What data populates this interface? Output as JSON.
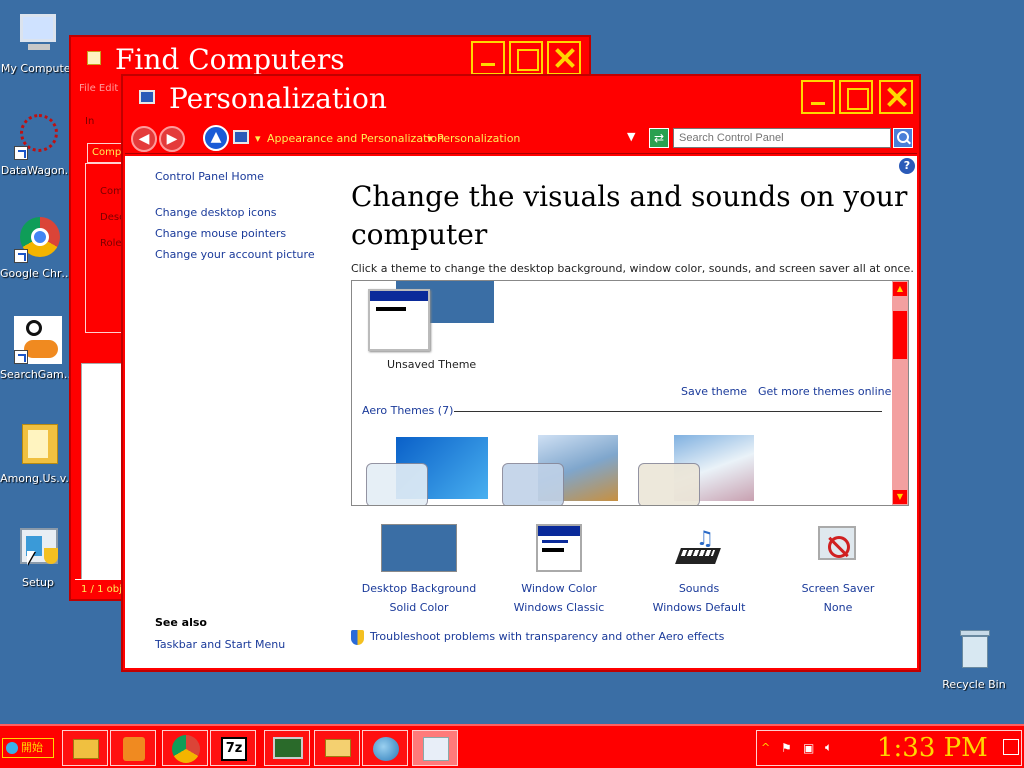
{
  "desktop": {
    "icons": [
      {
        "label": "My Computer"
      },
      {
        "label": "DataWagon..."
      },
      {
        "label": "Google Chrome"
      },
      {
        "label": "SearchGame..."
      },
      {
        "label": "Among.Us.v..."
      },
      {
        "label": "Setup"
      },
      {
        "label": "Recycle Bin"
      }
    ]
  },
  "find_window": {
    "title": "Find Computers",
    "frag_menu": "File  Edit",
    "frag_in": "In",
    "frag_tab": "Compu",
    "frag_row1": "Com",
    "frag_row2": "Desc",
    "frag_row3": "Role",
    "frag_status": "1 / 1 obj"
  },
  "pers_window": {
    "title": "Personalization",
    "breadcrumb": [
      "Appearance and Personalization",
      "Personalization"
    ],
    "search_placeholder": "Search Control Panel",
    "help": "?",
    "sidebar": {
      "home": "Control Panel Home",
      "links": [
        "Change desktop icons",
        "Change mouse pointers",
        "Change your account picture"
      ],
      "see_also_title": "See also",
      "see_also_links": [
        "Taskbar and Start Menu"
      ]
    },
    "heading": "Change the visuals and sounds on your computer",
    "subtitle": "Click a theme to change the desktop background, window color, sounds, and screen saver all at once.",
    "themes": {
      "unsaved": "Unsaved Theme",
      "save_theme": "Save theme",
      "get_more": "Get more themes online",
      "aero_group": "Aero Themes (7)"
    },
    "bottom": [
      {
        "title": "Desktop Background",
        "value": "Solid Color"
      },
      {
        "title": "Window Color",
        "value": "Windows Classic"
      },
      {
        "title": "Sounds",
        "value": "Windows Default"
      },
      {
        "title": "Screen Saver",
        "value": "None"
      }
    ],
    "troubleshoot": "Troubleshoot problems with transparency and other Aero effects"
  },
  "taskbar": {
    "start_label": "開始",
    "clock": "1:33 PM"
  },
  "colors": {
    "desktop": "#3a6ea5",
    "window_frame": "#ff0000",
    "title_text": "#ffffff",
    "caption_buttons": "#ffd700",
    "link": "#1a3a9a"
  }
}
